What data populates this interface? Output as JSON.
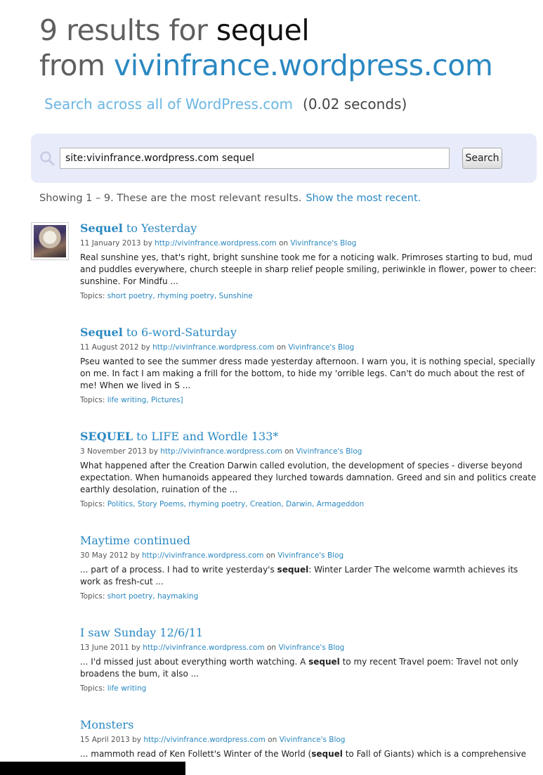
{
  "header": {
    "count_text": "9 results for ",
    "query": "sequel",
    "from_text": "from ",
    "site": "vivinfrance.wordpress.com",
    "search_all_link": "Search across all of WordPress.com",
    "time": "(0.02 seconds)"
  },
  "search": {
    "value": "site:vivinfrance.wordpress.com sequel",
    "button": "Search"
  },
  "showing": {
    "text": "Showing 1 – 9.   These are the most relevant results.",
    "recent_link": "Show the most recent."
  },
  "meta_common": {
    "by": " by ",
    "on": " on ",
    "topics_label": "Topics: "
  },
  "results": [
    {
      "title_bold": "Sequel",
      "title_rest": " to Yesterday",
      "date": "11 January 2013",
      "author": "http://vivinfrance.wordpress.com",
      "blog": "Vivinfrance's Blog",
      "snippet": "Real sunshine yes, that's right, bright sunshine took me for a noticing walk. Primroses starting to bud, mud and puddles everywhere, church steeple in sharp relief people smiling, periwinkle in flower, power to cheer: sunshine. For Mindfu ...",
      "topics": "short poetry, rhyming poetry, Sunshine"
    },
    {
      "title_bold": "Sequel",
      "title_rest": " to 6-word-Saturday",
      "date": "11 August 2012",
      "author": "http://vivinfrance.wordpress.com",
      "blog": "Vivinfrance's Blog",
      "snippet": "Pseu wanted to see the summer dress made yesterday afternoon.  I warn you, it is nothing special, specially on me.  In fact I am making a frill for the bottom, to hide my 'orrible legs.  Can't do much about the rest of me!  When we lived in S ...",
      "topics": "life writing, Pictures]"
    },
    {
      "title_bold": "SEQUEL",
      "title_rest": " to LIFE and Wordle 133*",
      "date": "3 November 2013",
      "author": "http://vivinfrance.wordpress.com",
      "blog": "Vivinfrance's Blog",
      "snippet": "What happened after the Creation Darwin called evolution, the development of species - diverse beyond expectation. When humanoids appeared they lurched towards damnation. Greed and sin and politics create  earthly desolation, ruination of the  ...",
      "topics": "Politics, Story Poems, rhyming poetry, Creation, Darwin, Armageddon"
    },
    {
      "title_bold": "",
      "title_rest": "Maytime continued",
      "date": "30 May 2012",
      "author": "http://vivinfrance.wordpress.com",
      "blog": "Vivinfrance's Blog",
      "snippet_pre": "...  part of a process.  I had to write yesterday's ",
      "snippet_hl": "sequel",
      "snippet_post": ": Winter Larder The welcome warmth achieves its work as fresh-cut ...",
      "topics": "short poetry, haymaking"
    },
    {
      "title_bold": "",
      "title_rest": "I saw Sunday 12/6/11",
      "date": "13 June 2011",
      "author": "http://vivinfrance.wordpress.com",
      "blog": "Vivinfrance's Blog",
      "snippet_pre": "...  I'd missed just about everything worth watching.  A ",
      "snippet_hl": "sequel",
      "snippet_post": " to my recent Travel poem: Travel not only broadens the bum, it also ...",
      "topics": "life writing"
    },
    {
      "title_bold": "",
      "title_rest": "Monsters",
      "date": "15 April 2013",
      "author": "http://vivinfrance.wordpress.com",
      "blog": "Vivinfrance's Blog",
      "snippet_pre": "...  mammoth read of Ken Follett's Winter of the World (",
      "snippet_hl": "sequel",
      "snippet_post": " to Fall of Giants) which is a comprehensive historical",
      "topics": ""
    }
  ],
  "icons": {
    "search": "search-icon",
    "avatar": "avatar"
  },
  "colors": {
    "link": "#2a88c2",
    "search_panel": "#e8ebfa",
    "light_link": "#6bb6e2"
  }
}
